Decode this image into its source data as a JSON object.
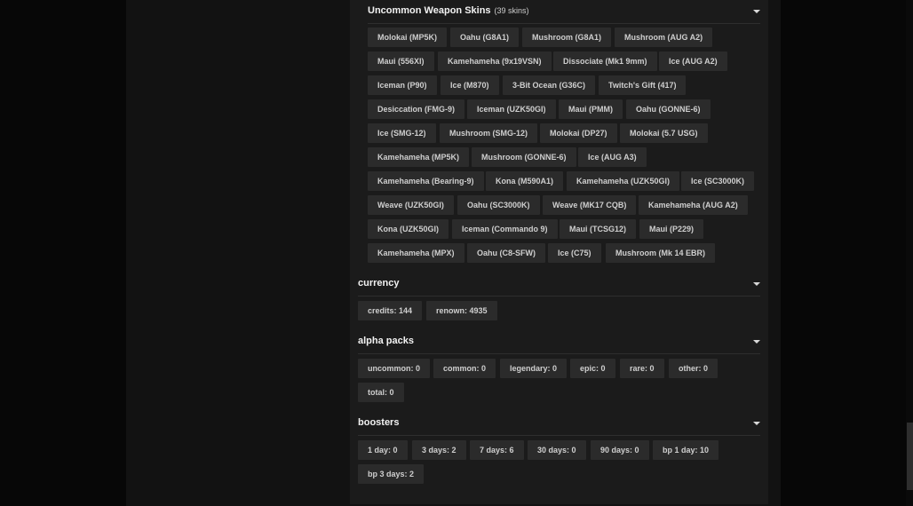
{
  "uncommon_weapon_skins": {
    "title": "Uncommon Weapon Skins",
    "count": "(39 skins)",
    "items": [
      "Molokai (MP5K)",
      "Oahu (G8A1)",
      "Mushroom (G8A1)",
      "Mushroom (AUG A2)",
      "Maui (556XI)",
      "Kamehameha (9x19VSN)",
      "Dissociate (Mk1 9mm)",
      "Ice (AUG A2)",
      "Iceman (P90)",
      "Ice (M870)",
      "3-Bit Ocean (G36C)",
      "Twitch's Gift (417)",
      "Desiccation (FMG-9)",
      "Iceman (UZK50GI)",
      "Maui (PMM)",
      "Oahu (GONNE-6)",
      "Ice (SMG-12)",
      "Mushroom (SMG-12)",
      "Molokai (DP27)",
      "Molokai (5.7 USG)",
      "Kamehameha (MP5K)",
      "Mushroom (GONNE-6)",
      "Ice (AUG A3)",
      "Kamehameha (Bearing-9)",
      "Kona (M590A1)",
      "Kamehameha (UZK50GI)",
      "Ice (SC3000K)",
      "Weave (UZK50GI)",
      "Oahu (SC3000K)",
      "Weave (MK17 CQB)",
      "Kamehameha (AUG A2)",
      "Kona (UZK50GI)",
      "Iceman (Commando 9)",
      "Maui (TCSG12)",
      "Maui (P229)",
      "Kamehameha (MPX)",
      "Oahu (C8-SFW)",
      "Ice (C75)",
      "Mushroom (Mk 14 EBR)"
    ]
  },
  "currency": {
    "title": "currency",
    "items": [
      "credits: 144",
      "renown: 4935"
    ]
  },
  "alpha_packs": {
    "title": "alpha packs",
    "items": [
      "uncommon: 0",
      "common: 0",
      "legendary: 0",
      "epic: 0",
      "rare: 0",
      "other: 0",
      "total: 0"
    ]
  },
  "boosters": {
    "title": "boosters",
    "items": [
      "1 day: 0",
      "3 days: 2",
      "7 days: 6",
      "30 days: 0",
      "90 days: 0",
      "bp 1 day: 10",
      "bp 3 days: 2"
    ]
  },
  "colors": {
    "page_background": "#0d0d0d",
    "panel_background": "#1b1b1b",
    "chip_background": "#2b2b2b",
    "chip_text": "#cfcfcf",
    "heading_text": "#f2f2f2"
  }
}
